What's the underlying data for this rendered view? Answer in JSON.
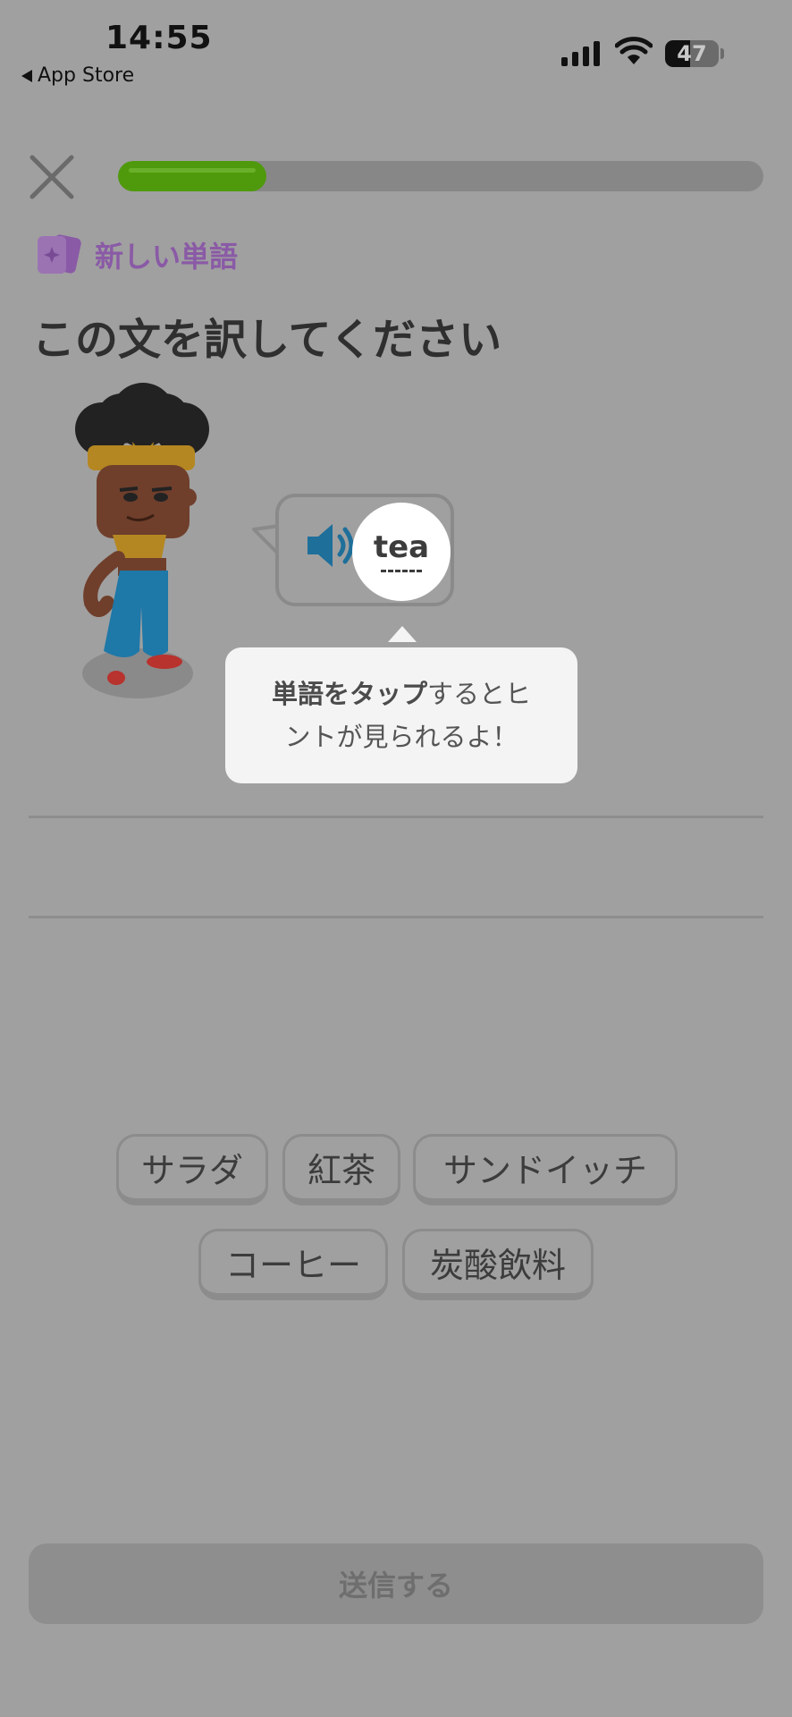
{
  "status_bar": {
    "time": "14:55",
    "back_label": "App Store",
    "battery_level": 47,
    "battery_text": "47"
  },
  "header": {
    "progress": 0.23,
    "progress_color": "#4f9a0c"
  },
  "lesson": {
    "badge_label": "新しい単語",
    "badge_color": "#8a5aa6",
    "instruction": "この文を訳してください",
    "prompt_word": "tea",
    "tooltip_bold": "単語をタップ",
    "tooltip_line1_rest": "するとヒ",
    "tooltip_line2": "ントが見られるよ！"
  },
  "word_bank": {
    "row1": [
      "サラダ",
      "紅茶",
      "サンドイッチ"
    ],
    "row2": [
      "コーヒー",
      "炭酸飲料"
    ]
  },
  "footer": {
    "submit_label": "送信する"
  },
  "icons": [
    "close-icon",
    "sparkle-card-icon",
    "speaker-icon",
    "signal-icon",
    "wifi-icon",
    "battery-icon"
  ]
}
